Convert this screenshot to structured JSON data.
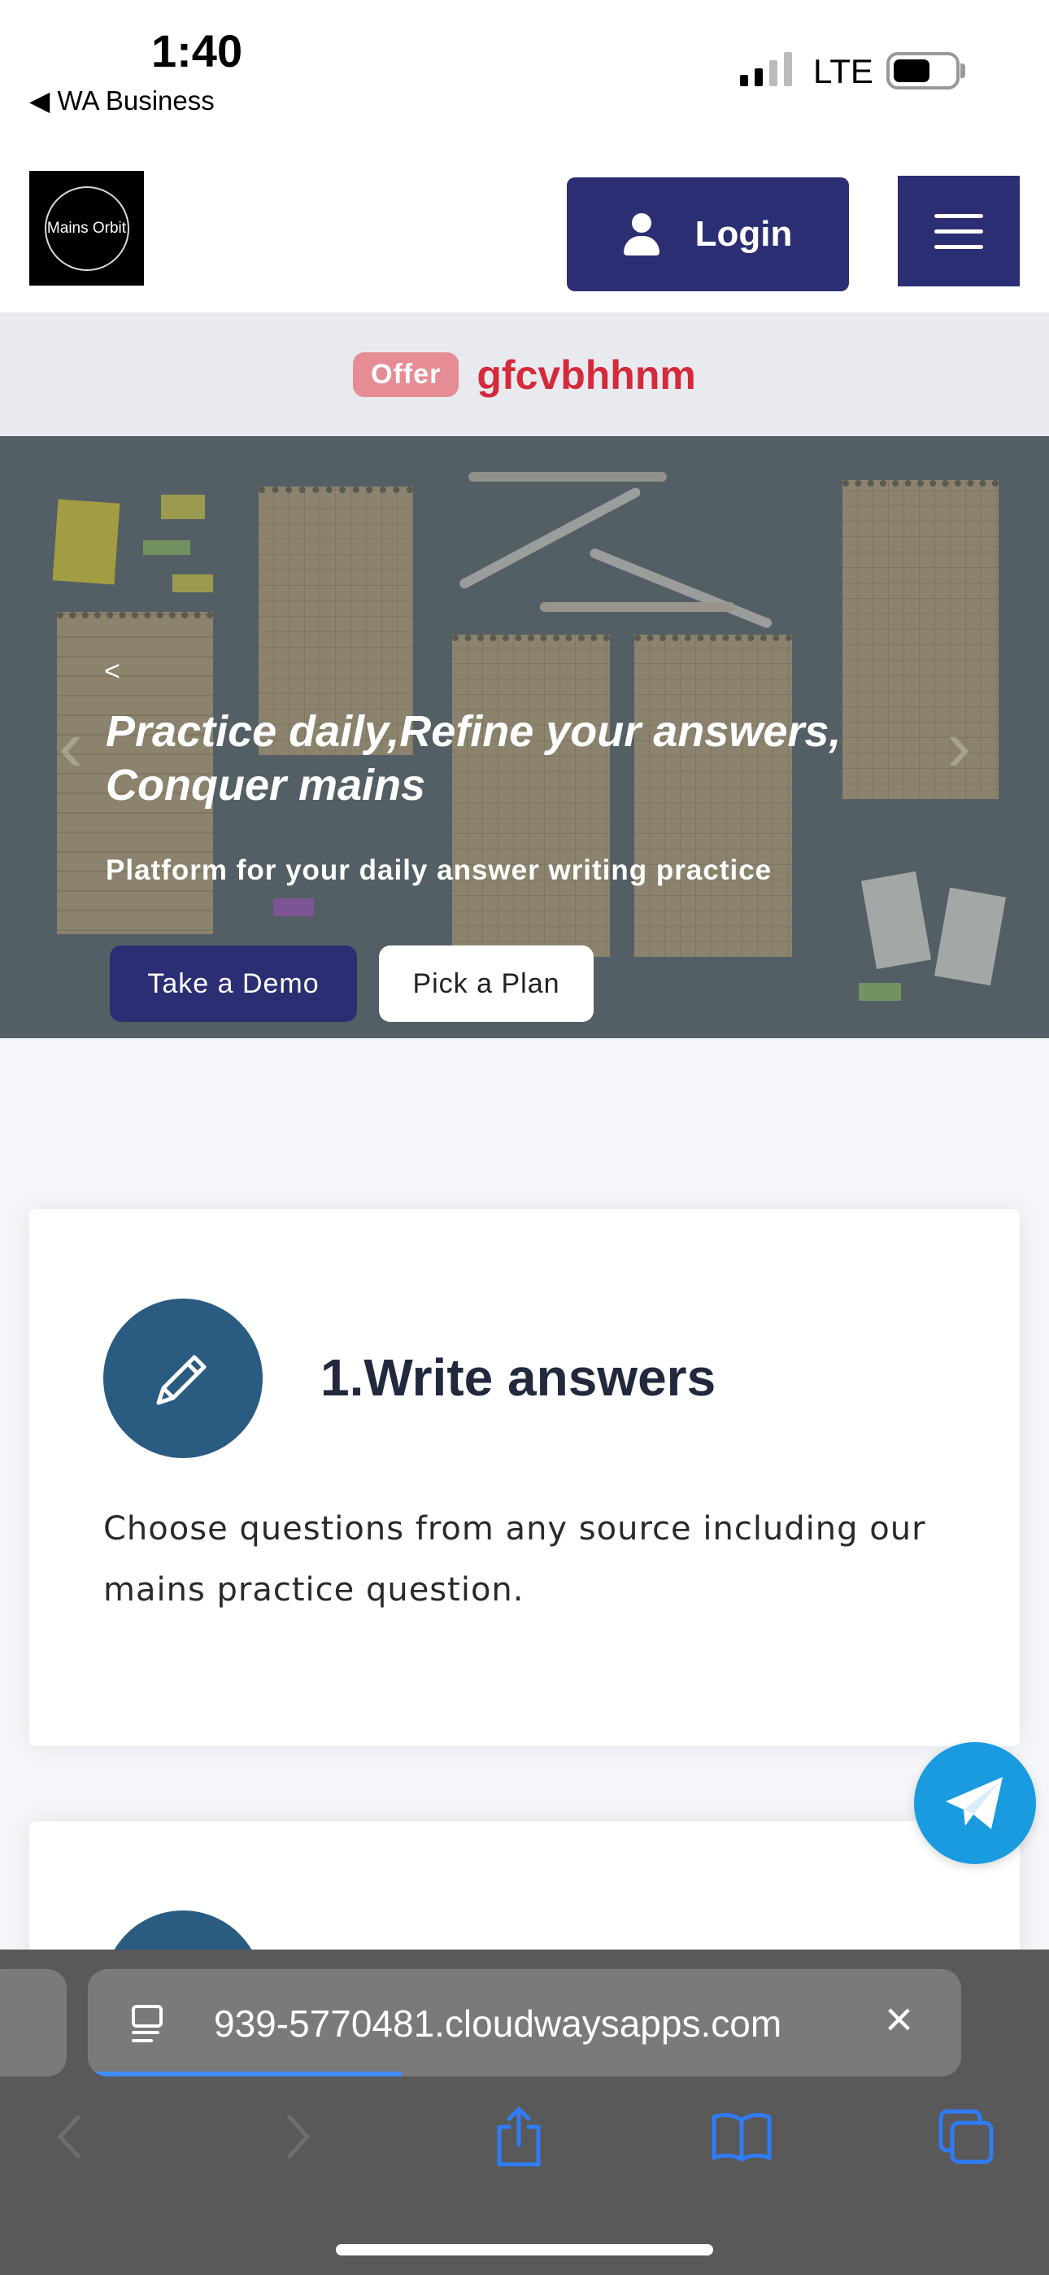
{
  "status_bar": {
    "time": "1:40",
    "back_app": "◀ WA Business",
    "network": "LTE"
  },
  "header": {
    "logo_text": "Mains Orbit",
    "login_label": "Login",
    "menu_icon": "hamburger-icon"
  },
  "offer": {
    "badge": "Offer",
    "text": "gfcvbhhnm"
  },
  "hero": {
    "prev": "<",
    "title": "Practice daily,Refine your answers, Conquer mains",
    "subtitle": "Platform for your daily answer writing practice",
    "demo_label": "Take a Demo",
    "plan_label": "Pick a Plan"
  },
  "steps": [
    {
      "icon": "pencil-icon",
      "title": "1.Write answers",
      "description": "Choose questions from any source including our mains practice question."
    }
  ],
  "browser": {
    "url": "939-5770481.cloudwaysapps.com",
    "close": "×"
  },
  "colors": {
    "primary": "#2b2e72",
    "offer_red": "#d42a3b",
    "step_circle": "#2a5b81",
    "telegram": "#1a9be0"
  }
}
